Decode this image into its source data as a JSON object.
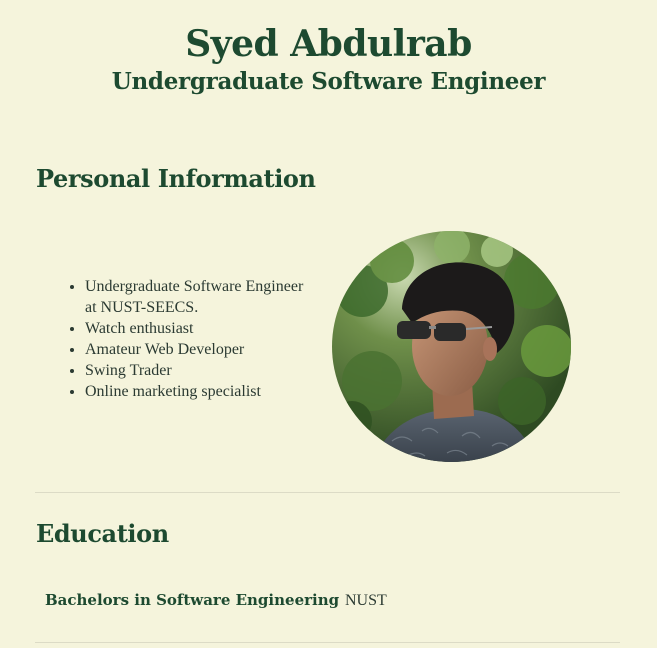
{
  "header": {
    "name": "Syed Abdulrab",
    "role": "Undergraduate Software Engineer"
  },
  "personal": {
    "title": "Personal Information",
    "items": [
      "Undergraduate Software Engineer at NUST-SEECS.",
      "Watch enthusiast",
      "Amateur Web Developer",
      "Swing Trader",
      "Online marketing specialist"
    ],
    "photo_icon": "profile-photo"
  },
  "education": {
    "title": "Education",
    "degree": "Bachelors in Software Engineering",
    "institution": "NUST"
  },
  "colors": {
    "background": "#f5f4dc",
    "heading": "#1d4a30",
    "text": "#2b3a32",
    "divider": "#dcdbc6"
  }
}
